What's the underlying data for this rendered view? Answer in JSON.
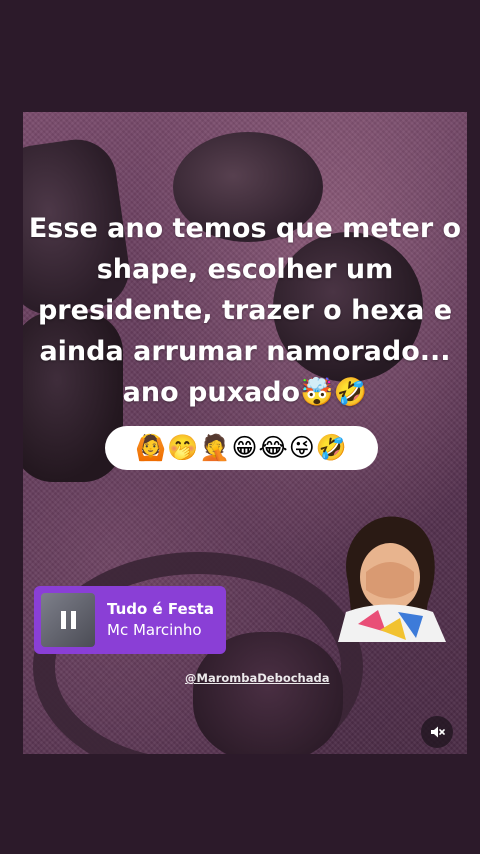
{
  "story": {
    "caption_lines": [
      "Esse ano temos que meter o",
      "shape, escolher um",
      "presidente, trazer o hexa e",
      "ainda arrumar  namorado...",
      "ano puxado🤯🤣"
    ],
    "emoji_strip": "🙆🤭🤦😁😂😜🤣",
    "handle": "@MarombaDebochada"
  },
  "music": {
    "title": "Tudo é Festa",
    "artist": "Mc Marcinho",
    "art_icon": "pause-icon"
  },
  "controls": {
    "mute_icon": "muted-speaker-icon"
  },
  "colors": {
    "background": "#2c1a2a",
    "music_card": "#8a3fd6"
  }
}
